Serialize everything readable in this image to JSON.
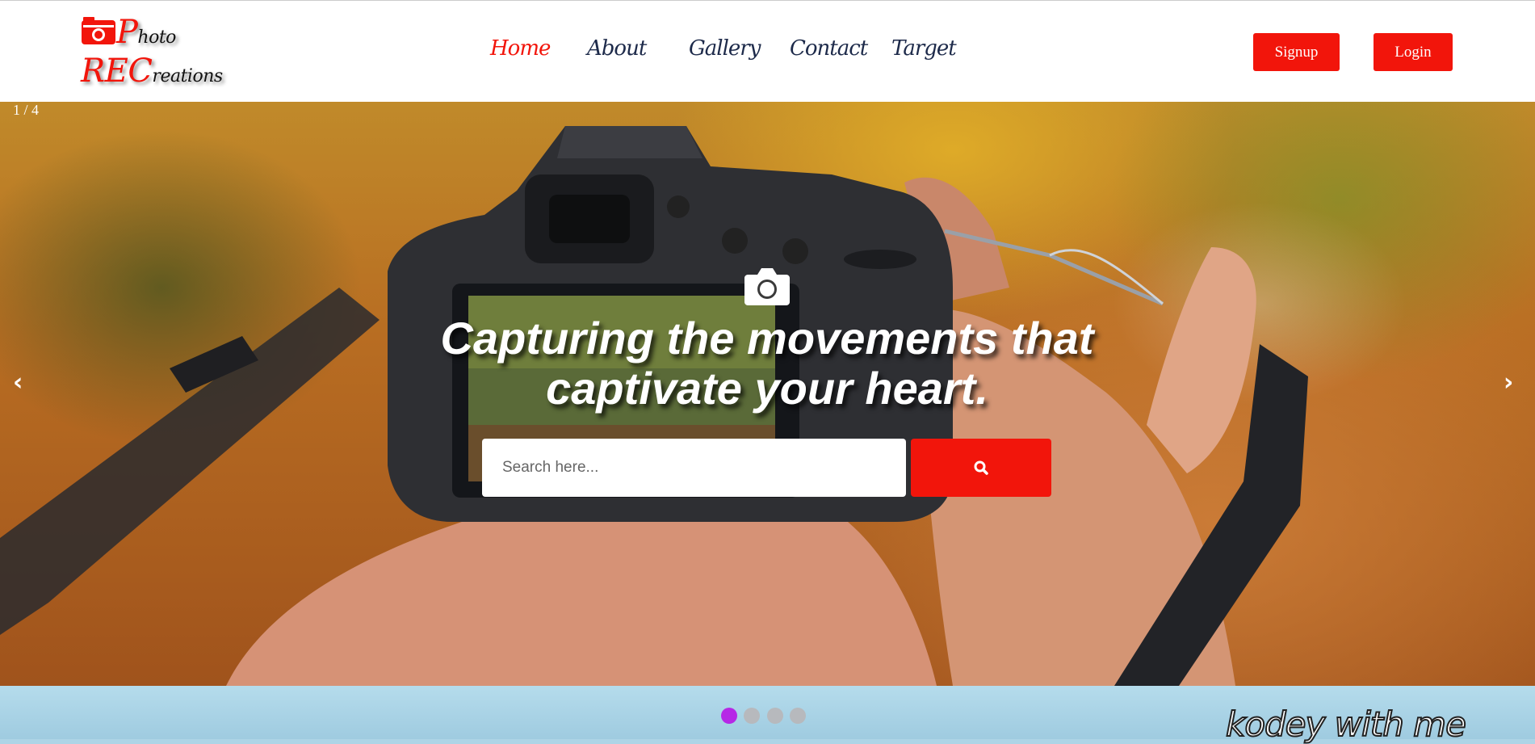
{
  "brand": {
    "line1_first": "P",
    "line1_rest": "hoto",
    "line2_first": "REC",
    "line2_rest": "reations",
    "icon": "camera-icon",
    "accent": "#f2150b"
  },
  "nav": {
    "items": [
      {
        "label": "Home",
        "active": true
      },
      {
        "label": "About",
        "active": false
      },
      {
        "label": "Gallery",
        "active": false
      },
      {
        "label": "Contact",
        "active": false
      },
      {
        "label": "Target",
        "active": false
      }
    ]
  },
  "auth": {
    "signup_label": "Signup",
    "login_label": "Login"
  },
  "hero": {
    "slide_counter": "1 / 4",
    "prev_label": "‹",
    "next_label": "›",
    "headline": "Capturing the movements that captivate your heart.",
    "center_icon": "camera-icon"
  },
  "search": {
    "placeholder": "Search here...",
    "value": "",
    "button_icon": "search-icon"
  },
  "slider": {
    "total_slides": 4,
    "active_index": 0,
    "active_color": "#b627e6",
    "inactive_color": "#b7b9bd"
  },
  "watermark": "kodey with me"
}
